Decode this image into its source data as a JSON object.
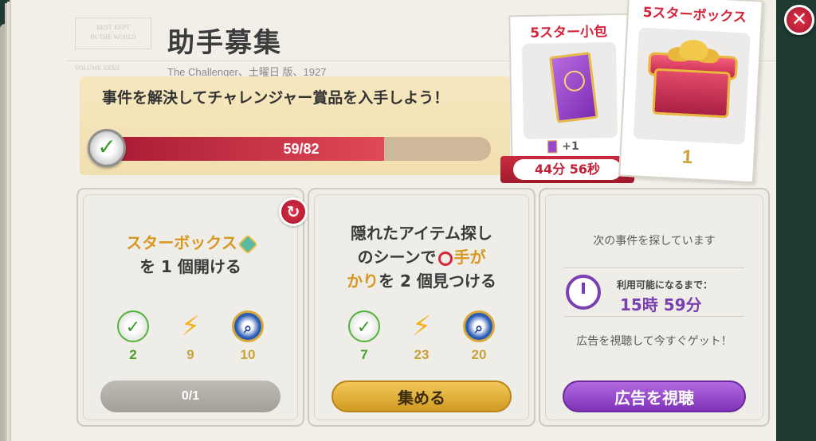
{
  "masthead": {
    "logo_line1": "BEST KEPT",
    "logo_line2": "IN THE WORLD",
    "sub": "VOLUME XXXII"
  },
  "header": {
    "title": "助手募集",
    "byline": "The Challenger、土曜日 版、1927"
  },
  "banner": {
    "text": "事件を解決してチャレンジャー賞品を入手しよう！",
    "progress_label": "59/82",
    "progress_fraction": 0.7195
  },
  "rewards": {
    "small": {
      "title": "5スター小包",
      "plus": "+1",
      "timer": "44分 56秒"
    },
    "big": {
      "title": "5スターボックス",
      "count": "1"
    }
  },
  "tasks": [
    {
      "line1": "スターボックス",
      "line2": "を 1 個開ける",
      "rewards": [
        {
          "icon": "check-badge-icon",
          "value": "2"
        },
        {
          "icon": "lightning-icon",
          "value": "9"
        },
        {
          "icon": "magnifier-coin-icon",
          "value": "10"
        }
      ],
      "button": "0/1"
    },
    {
      "line1": "隠れたアイテム探し",
      "line2a": "のシーンで",
      "line2b": "手が",
      "line3a": "かり",
      "line3b": "を 2 個見つける",
      "rewards": [
        {
          "icon": "check-badge-icon",
          "value": "7"
        },
        {
          "icon": "lightning-icon",
          "value": "23"
        },
        {
          "icon": "magnifier-coin-icon",
          "value": "20"
        }
      ],
      "button": "集める"
    },
    {
      "searching": "次の事件を探しています",
      "avail_label": "利用可能になるまで：",
      "avail_time": "15時 59分",
      "ad_text": "広告を視聴して今すぐゲット！",
      "button": "広告を視聴"
    }
  ],
  "colors": {
    "progress_fill": "#d6253b",
    "accent_gold": "#d79822",
    "accent_purple": "#7a3fb0"
  }
}
